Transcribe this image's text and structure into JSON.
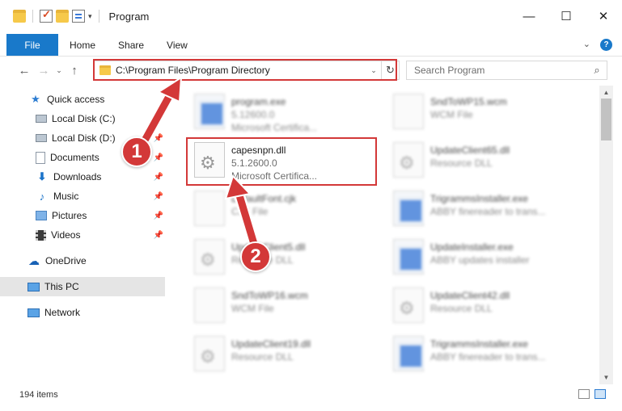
{
  "window": {
    "title": "Program",
    "controls": {
      "minimize": "—",
      "maximize": "☐",
      "close": "✕"
    }
  },
  "ribbon": {
    "tabs": [
      "File",
      "Home",
      "Share",
      "View"
    ],
    "expand_glyph": "⌄",
    "help_glyph": "?"
  },
  "nav": {
    "back_glyph": "←",
    "forward_glyph": "→",
    "recent_glyph": "⌄",
    "up_glyph": "↑",
    "address": "C:\\Program Files\\Program Directory",
    "address_dropdown": "⌄",
    "refresh_glyph": "↻",
    "search_placeholder": "Search Program",
    "search_glyph": "⌕"
  },
  "sidebar": {
    "items": [
      {
        "label": "Quick access",
        "icon": "star-icon",
        "pinned": false
      },
      {
        "label": "Local Disk (C:)",
        "icon": "disk-icon",
        "pinned": true
      },
      {
        "label": "Local Disk (D:)",
        "icon": "disk-icon",
        "pinned": true
      },
      {
        "label": "Documents",
        "icon": "documents-icon",
        "pinned": true
      },
      {
        "label": "Downloads",
        "icon": "download-icon",
        "pinned": true
      },
      {
        "label": "Music",
        "icon": "music-icon",
        "pinned": true
      },
      {
        "label": "Pictures",
        "icon": "pictures-icon",
        "pinned": true
      },
      {
        "label": "Videos",
        "icon": "videos-icon",
        "pinned": true
      },
      {
        "label": "OneDrive",
        "icon": "cloud-icon",
        "pinned": false
      },
      {
        "label": "This PC",
        "icon": "computer-icon",
        "pinned": false,
        "selected": true
      },
      {
        "label": "Network",
        "icon": "network-icon",
        "pinned": false
      }
    ],
    "pin_glyph": "📌"
  },
  "files": [
    {
      "name": "program.exe",
      "line1": "5.12600.0",
      "line2": "Microsoft Certifica...",
      "type": "exe",
      "blurred": true
    },
    {
      "name": "SndToWP15.wcm",
      "line1": "WCM File",
      "line2": "",
      "type": "doc",
      "blurred": true
    },
    {
      "name": "capesnpn.dll",
      "line1": "5.1.2600.0",
      "line2": "Microsoft Certifica...",
      "type": "dll",
      "blurred": false
    },
    {
      "name": "UpdateClient65.dll",
      "line1": "Resource DLL",
      "line2": "",
      "type": "dll",
      "blurred": true
    },
    {
      "name": "DefaultFont.cjk",
      "line1": "CJK File",
      "line2": "",
      "type": "doc",
      "blurred": true
    },
    {
      "name": "TrigrammsInstaller.exe",
      "line1": "ABBY finereader to trans...",
      "line2": "",
      "type": "exe",
      "blurred": true
    },
    {
      "name": "UpdateClient5.dll",
      "line1": "Resource DLL",
      "line2": "",
      "type": "dll",
      "blurred": true
    },
    {
      "name": "UpdateInstaller.exe",
      "line1": "ABBY updates installer",
      "line2": "",
      "type": "exe",
      "blurred": true
    },
    {
      "name": "SndToWP16.wcm",
      "line1": "WCM File",
      "line2": "",
      "type": "doc",
      "blurred": true
    },
    {
      "name": "UpdateClient42.dll",
      "line1": "Resource DLL",
      "line2": "",
      "type": "dll",
      "blurred": true
    },
    {
      "name": "UpdateClient19.dll",
      "line1": "Resource DLL",
      "line2": "",
      "type": "dll",
      "blurred": true
    },
    {
      "name": "TrigrammsInstaller.exe",
      "line1": "ABBY finereader to trans...",
      "line2": "",
      "type": "exe",
      "blurred": true
    }
  ],
  "scroll": {
    "up": "▲",
    "down": "▼"
  },
  "status": {
    "item_count": "194 items"
  },
  "annotations": {
    "step1": "1",
    "step2": "2",
    "color": "#d33838"
  }
}
